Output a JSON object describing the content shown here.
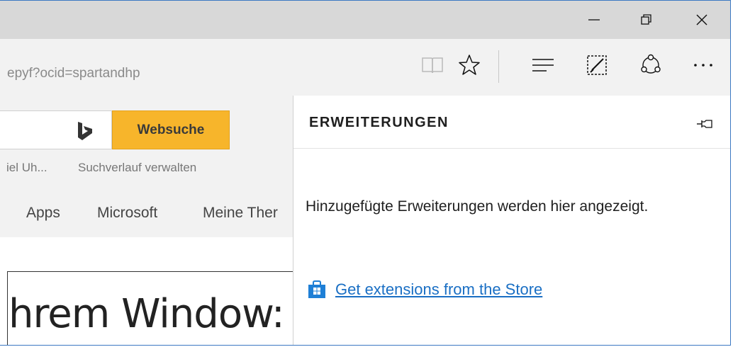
{
  "address": {
    "url_fragment": "epyf?ocid=spartandhp"
  },
  "page": {
    "search_button": "Websuche",
    "history_links": [
      "iel Uh...",
      "Suchverlauf verwalten"
    ],
    "nav_links": [
      "Apps",
      "Microsoft",
      "Meine Ther"
    ],
    "heading": "hrem Window:"
  },
  "pane": {
    "title": "ERWEITERUNGEN",
    "message": "Hinzugefügte Erweiterungen werden hier angezeigt.",
    "store_link": "Get extensions from the Store"
  },
  "colors": {
    "accent": "#1a6fc4",
    "search_button": "#f7b52b",
    "store_icon": "#1e7fd6"
  }
}
